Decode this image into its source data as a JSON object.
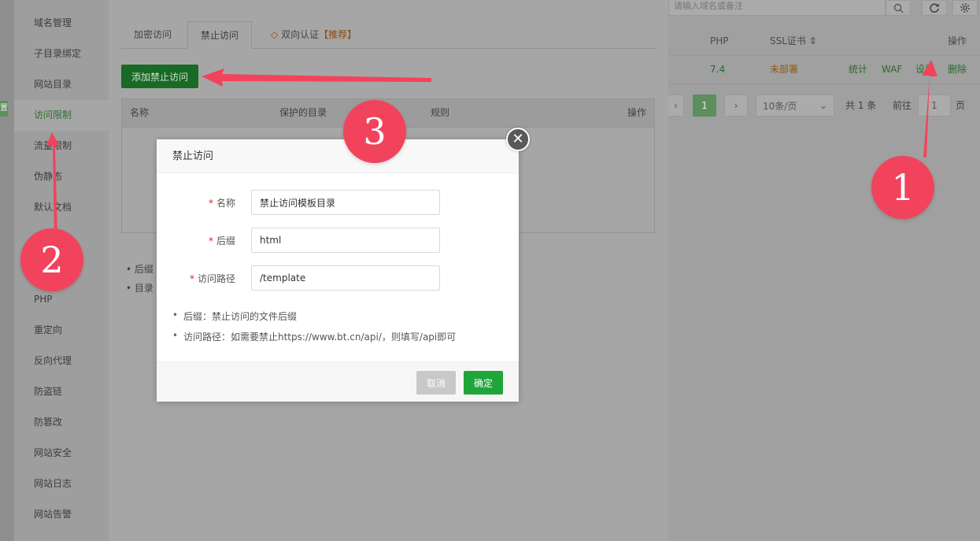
{
  "background_list": {
    "search_placeholder": "请输入域名或备注",
    "columns": {
      "php": "PHP",
      "ssl": "SSL证书",
      "ops": "操作"
    },
    "row": {
      "php": "7.4",
      "ssl": "未部署",
      "actions": [
        "统计",
        "WAF",
        "设置",
        "删除"
      ]
    },
    "pagination": {
      "current": "1",
      "page_size": "10条/页",
      "total": "共 1 条",
      "goto_label": "前往",
      "goto_value": "1",
      "page_unit": "页"
    },
    "edge_tag": "置"
  },
  "sidebar": {
    "items": [
      {
        "label": "域名管理"
      },
      {
        "label": "子目录绑定"
      },
      {
        "label": "网站目录"
      },
      {
        "label": "访问限制"
      },
      {
        "label": "流量限制"
      },
      {
        "label": "伪静态"
      },
      {
        "label": "默认文档"
      },
      {
        "label": "PHP"
      },
      {
        "label": "重定向"
      },
      {
        "label": "反向代理"
      },
      {
        "label": "防盗链"
      },
      {
        "label": "防篡改"
      },
      {
        "label": "网站安全"
      },
      {
        "label": "网站日志"
      },
      {
        "label": "网站告警"
      }
    ],
    "active_index": 3
  },
  "tabs": {
    "items": [
      "加密访问",
      "禁止访问"
    ],
    "two_factor": "双向认证",
    "recommended": "【推荐】",
    "active": "禁止访问"
  },
  "add_button_label": "添加禁止访问",
  "table": {
    "headers": [
      "名称",
      "保护的目录",
      "规则",
      "操作"
    ]
  },
  "notes": [
    "后缀",
    "目录"
  ],
  "modal": {
    "title": "禁止访问",
    "fields": [
      {
        "label": "名称",
        "value": "禁止访问模板目录"
      },
      {
        "label": "后缀",
        "value": "html"
      },
      {
        "label": "访问路径",
        "value": "/template"
      }
    ],
    "tips": [
      "后缀：禁止访问的文件后缀",
      "访问路径：如需要禁止https://www.bt.cn/api/，则填写/api即可"
    ],
    "cancel_label": "取消",
    "confirm_label": "确定"
  },
  "annotations": {
    "badge_1": "1",
    "badge_2": "2",
    "badge_3": "3",
    "color": "#f2435c"
  }
}
